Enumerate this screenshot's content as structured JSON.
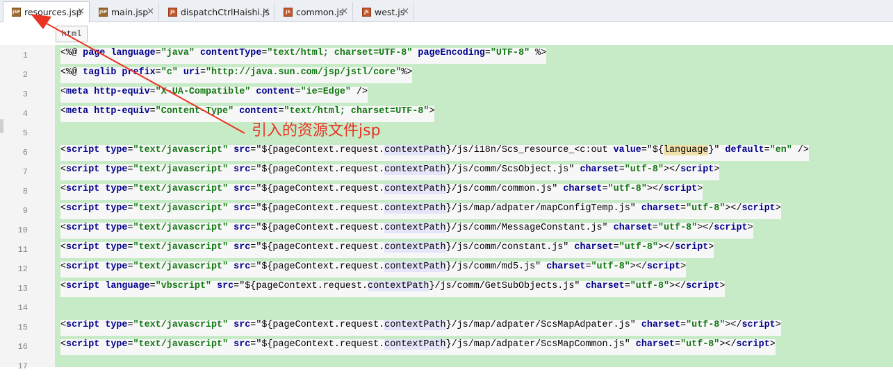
{
  "tabs": [
    {
      "label": "resources.jsp",
      "icon": "jsp-file-icon",
      "active": true
    },
    {
      "label": "main.jsp",
      "icon": "jsp-file-icon",
      "active": false
    },
    {
      "label": "dispatchCtrlHaishi.js",
      "icon": "js-file-icon",
      "active": false
    },
    {
      "label": "common.js",
      "icon": "js-file-icon",
      "active": false
    },
    {
      "label": "west.js",
      "icon": "js-file-icon",
      "active": false
    }
  ],
  "tab_close_glyph": "×",
  "file_icon_text": {
    "jsp": "JSP",
    "js": "JS"
  },
  "editor_tab_label": "html",
  "annotation": {
    "text": "引入的资源文件jsp",
    "color": "#ea3323"
  },
  "colors": {
    "selection_green": "#c7ebc7",
    "keyword": "#00008b",
    "string": "#117711",
    "annotation": "#ea3323"
  },
  "lines": [
    {
      "n": "1",
      "tokens": [
        [
          "<%@ ",
          "p"
        ],
        [
          "page",
          "kw"
        ],
        [
          " ",
          "p"
        ],
        [
          "language",
          "kw"
        ],
        [
          "=",
          "p"
        ],
        [
          "\"java\"",
          "str"
        ],
        [
          " ",
          "p"
        ],
        [
          "contentType",
          "kw"
        ],
        [
          "=",
          "p"
        ],
        [
          "\"text/html; charset=UTF-8\"",
          "str"
        ],
        [
          " ",
          "p"
        ],
        [
          "pageEncoding",
          "kw"
        ],
        [
          "=",
          "p"
        ],
        [
          "\"UTF-8\"",
          "str"
        ],
        [
          " %>",
          "p"
        ]
      ]
    },
    {
      "n": "2",
      "tokens": [
        [
          "<%@ ",
          "p"
        ],
        [
          "taglib",
          "kw"
        ],
        [
          " ",
          "p"
        ],
        [
          "prefix",
          "kw"
        ],
        [
          "=",
          "p"
        ],
        [
          "\"c\"",
          "str"
        ],
        [
          " ",
          "p"
        ],
        [
          "uri",
          "kw"
        ],
        [
          "=",
          "p"
        ],
        [
          "\"http://java.sun.com/jsp/jstl/core\"",
          "str"
        ],
        [
          "%>",
          "p"
        ]
      ]
    },
    {
      "n": "3",
      "tokens": [
        [
          "<",
          "p"
        ],
        [
          "meta",
          "kw"
        ],
        [
          " ",
          "p"
        ],
        [
          "http-equiv",
          "kw"
        ],
        [
          "=",
          "p"
        ],
        [
          "\"X-UA-Compatible\"",
          "str"
        ],
        [
          " ",
          "p"
        ],
        [
          "content",
          "kw"
        ],
        [
          "=",
          "p"
        ],
        [
          "\"ie=Edge\"",
          "str"
        ],
        [
          " />",
          "p"
        ]
      ]
    },
    {
      "n": "4",
      "tokens": [
        [
          "<",
          "p"
        ],
        [
          "meta",
          "kw"
        ],
        [
          " ",
          "p"
        ],
        [
          "http-equiv",
          "kw"
        ],
        [
          "=",
          "p"
        ],
        [
          "\"Content-Type\"",
          "str"
        ],
        [
          " ",
          "p"
        ],
        [
          "content",
          "kw"
        ],
        [
          "=",
          "p"
        ],
        [
          "\"text/html; charset=UTF-8\"",
          "str"
        ],
        [
          ">",
          "p"
        ]
      ]
    },
    {
      "n": "5",
      "tokens": []
    },
    {
      "n": "6",
      "tokens": [
        [
          "<",
          "p"
        ],
        [
          "script",
          "kw"
        ],
        [
          " ",
          "p"
        ],
        [
          "type",
          "kw"
        ],
        [
          "=",
          "p"
        ],
        [
          "\"text/javascript\"",
          "str"
        ],
        [
          " ",
          "p"
        ],
        [
          "src",
          "kw"
        ],
        [
          "=",
          "p"
        ],
        [
          "\"${pageContext.request.",
          "p"
        ],
        [
          "contextPath",
          "ctx"
        ],
        [
          "}/js/i18n/Scs_resource_<c:out ",
          "p"
        ],
        [
          "value",
          "kw"
        ],
        [
          "=",
          "p"
        ],
        [
          "\"${",
          "p"
        ],
        [
          "language",
          "lang"
        ],
        [
          "}\"",
          "p"
        ],
        [
          " ",
          "p"
        ],
        [
          "default",
          "kw"
        ],
        [
          "=",
          "p"
        ],
        [
          "\"en\"",
          "str"
        ],
        [
          " />",
          "p"
        ]
      ]
    },
    {
      "n": "7",
      "tokens": [
        [
          "<",
          "p"
        ],
        [
          "script",
          "kw"
        ],
        [
          " ",
          "p"
        ],
        [
          "type",
          "kw"
        ],
        [
          "=",
          "p"
        ],
        [
          "\"text/javascript\"",
          "str"
        ],
        [
          " ",
          "p"
        ],
        [
          "src",
          "kw"
        ],
        [
          "=",
          "p"
        ],
        [
          "\"${pageContext.request.",
          "p"
        ],
        [
          "contextPath",
          "ctx"
        ],
        [
          "}/js/comm/ScsObject.js\"",
          "p"
        ],
        [
          " ",
          "p"
        ],
        [
          "charset",
          "kw"
        ],
        [
          "=",
          "p"
        ],
        [
          "\"utf-8\"",
          "str"
        ],
        [
          "></",
          "p"
        ],
        [
          "script",
          "kw"
        ],
        [
          ">",
          "p"
        ]
      ]
    },
    {
      "n": "8",
      "tokens": [
        [
          "<",
          "p"
        ],
        [
          "script",
          "kw"
        ],
        [
          " ",
          "p"
        ],
        [
          "type",
          "kw"
        ],
        [
          "=",
          "p"
        ],
        [
          "\"text/javascript\"",
          "str"
        ],
        [
          " ",
          "p"
        ],
        [
          "src",
          "kw"
        ],
        [
          "=",
          "p"
        ],
        [
          "\"${pageContext.request.",
          "p"
        ],
        [
          "contextPath",
          "ctx"
        ],
        [
          "}/js/comm/common.js\"",
          "p"
        ],
        [
          " ",
          "p"
        ],
        [
          "charset",
          "kw"
        ],
        [
          "=",
          "p"
        ],
        [
          "\"utf-8\"",
          "str"
        ],
        [
          "></",
          "p"
        ],
        [
          "script",
          "kw"
        ],
        [
          ">",
          "p"
        ]
      ]
    },
    {
      "n": "9",
      "tokens": [
        [
          "<",
          "p"
        ],
        [
          "script",
          "kw"
        ],
        [
          " ",
          "p"
        ],
        [
          "type",
          "kw"
        ],
        [
          "=",
          "p"
        ],
        [
          "\"text/javascript\"",
          "str"
        ],
        [
          " ",
          "p"
        ],
        [
          "src",
          "kw"
        ],
        [
          "=",
          "p"
        ],
        [
          "\"${pageContext.request.",
          "p"
        ],
        [
          "contextPath",
          "ctx"
        ],
        [
          "}/js/map/adpater/mapConfigTemp.js\"",
          "p"
        ],
        [
          " ",
          "p"
        ],
        [
          "charset",
          "kw"
        ],
        [
          "=",
          "p"
        ],
        [
          "\"utf-8\"",
          "str"
        ],
        [
          "></",
          "p"
        ],
        [
          "script",
          "kw"
        ],
        [
          ">",
          "p"
        ]
      ]
    },
    {
      "n": "10",
      "tokens": [
        [
          "<",
          "p"
        ],
        [
          "script",
          "kw"
        ],
        [
          " ",
          "p"
        ],
        [
          "type",
          "kw"
        ],
        [
          "=",
          "p"
        ],
        [
          "\"text/javascript\"",
          "str"
        ],
        [
          " ",
          "p"
        ],
        [
          "src",
          "kw"
        ],
        [
          "=",
          "p"
        ],
        [
          "\"${pageContext.request.",
          "p"
        ],
        [
          "contextPath",
          "ctx"
        ],
        [
          "}/js/comm/MessageConstant.js\"",
          "p"
        ],
        [
          " ",
          "p"
        ],
        [
          "charset",
          "kw"
        ],
        [
          "=",
          "p"
        ],
        [
          "\"utf-8\"",
          "str"
        ],
        [
          "></",
          "p"
        ],
        [
          "script",
          "kw"
        ],
        [
          ">",
          "p"
        ]
      ]
    },
    {
      "n": "11",
      "tokens": [
        [
          "<",
          "p"
        ],
        [
          "script",
          "kw"
        ],
        [
          " ",
          "p"
        ],
        [
          "type",
          "kw"
        ],
        [
          "=",
          "p"
        ],
        [
          "\"text/javascript\"",
          "str"
        ],
        [
          " ",
          "p"
        ],
        [
          "src",
          "kw"
        ],
        [
          "=",
          "p"
        ],
        [
          "\"${pageContext.request.",
          "p"
        ],
        [
          "contextPath",
          "ctx"
        ],
        [
          "}/js/comm/constant.js\"",
          "p"
        ],
        [
          " ",
          "p"
        ],
        [
          "charset",
          "kw"
        ],
        [
          "=",
          "p"
        ],
        [
          "\"utf-8\"",
          "str"
        ],
        [
          "></",
          "p"
        ],
        [
          "script",
          "kw"
        ],
        [
          ">",
          "p"
        ]
      ]
    },
    {
      "n": "12",
      "tokens": [
        [
          "<",
          "p"
        ],
        [
          "script",
          "kw"
        ],
        [
          " ",
          "p"
        ],
        [
          "type",
          "kw"
        ],
        [
          "=",
          "p"
        ],
        [
          "\"text/javascript\"",
          "str"
        ],
        [
          " ",
          "p"
        ],
        [
          "src",
          "kw"
        ],
        [
          "=",
          "p"
        ],
        [
          "\"${pageContext.request.",
          "p"
        ],
        [
          "contextPath",
          "ctx"
        ],
        [
          "}/js/comm/md5.js\"",
          "p"
        ],
        [
          " ",
          "p"
        ],
        [
          "charset",
          "kw"
        ],
        [
          "=",
          "p"
        ],
        [
          "\"utf-8\"",
          "str"
        ],
        [
          "></",
          "p"
        ],
        [
          "script",
          "kw"
        ],
        [
          ">",
          "p"
        ]
      ]
    },
    {
      "n": "13",
      "tokens": [
        [
          "<",
          "p"
        ],
        [
          "script",
          "kw"
        ],
        [
          " ",
          "p"
        ],
        [
          "language",
          "kw"
        ],
        [
          "=",
          "p"
        ],
        [
          "\"vbscript\"",
          "str"
        ],
        [
          " ",
          "p"
        ],
        [
          "src",
          "kw"
        ],
        [
          "=",
          "p"
        ],
        [
          "\"${pageContext.request.",
          "p"
        ],
        [
          "contextPath",
          "ctx"
        ],
        [
          "}/js/comm/GetSubObjects.js\"",
          "p"
        ],
        [
          " ",
          "p"
        ],
        [
          "charset",
          "kw"
        ],
        [
          "=",
          "p"
        ],
        [
          "\"utf-8\"",
          "str"
        ],
        [
          "></",
          "p"
        ],
        [
          "script",
          "kw"
        ],
        [
          ">",
          "p"
        ]
      ]
    },
    {
      "n": "14",
      "tokens": []
    },
    {
      "n": "15",
      "tokens": [
        [
          "<",
          "p"
        ],
        [
          "script",
          "kw"
        ],
        [
          " ",
          "p"
        ],
        [
          "type",
          "kw"
        ],
        [
          "=",
          "p"
        ],
        [
          "\"text/javascript\"",
          "str"
        ],
        [
          " ",
          "p"
        ],
        [
          "src",
          "kw"
        ],
        [
          "=",
          "p"
        ],
        [
          "\"${pageContext.request.",
          "p"
        ],
        [
          "contextPath",
          "ctx"
        ],
        [
          "}/js/map/adpater/ScsMapAdpater.js\"",
          "p"
        ],
        [
          " ",
          "p"
        ],
        [
          "charset",
          "kw"
        ],
        [
          "=",
          "p"
        ],
        [
          "\"utf-8\"",
          "str"
        ],
        [
          "></",
          "p"
        ],
        [
          "script",
          "kw"
        ],
        [
          ">",
          "p"
        ]
      ]
    },
    {
      "n": "16",
      "tokens": [
        [
          "<",
          "p"
        ],
        [
          "script",
          "kw"
        ],
        [
          " ",
          "p"
        ],
        [
          "type",
          "kw"
        ],
        [
          "=",
          "p"
        ],
        [
          "\"text/javascript\"",
          "str"
        ],
        [
          " ",
          "p"
        ],
        [
          "src",
          "kw"
        ],
        [
          "=",
          "p"
        ],
        [
          "\"${pageContext.request.",
          "p"
        ],
        [
          "contextPath",
          "ctx"
        ],
        [
          "}/js/map/adpater/ScsMapCommon.js\"",
          "p"
        ],
        [
          " ",
          "p"
        ],
        [
          "charset",
          "kw"
        ],
        [
          "=",
          "p"
        ],
        [
          "\"utf-8\"",
          "str"
        ],
        [
          "></",
          "p"
        ],
        [
          "script",
          "kw"
        ],
        [
          ">",
          "p"
        ]
      ]
    },
    {
      "n": "17",
      "tokens": []
    }
  ]
}
